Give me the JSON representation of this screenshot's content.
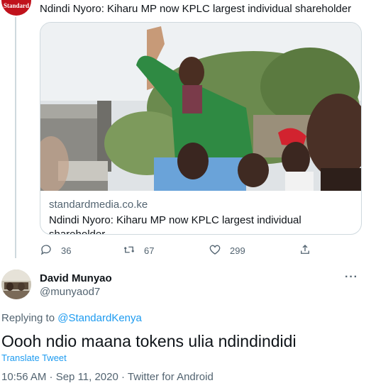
{
  "parent_tweet": {
    "avatar_text": "Standard",
    "text": "Ndindi Nyoro: Kiharu MP now KPLC largest individual shareholder"
  },
  "card": {
    "domain": "standardmedia.co.ke",
    "title": "Ndindi Nyoro: Kiharu MP now KPLC largest individual shareholder"
  },
  "actions": {
    "replies": "36",
    "retweets": "67",
    "likes": "299"
  },
  "reply_tweet": {
    "name": "David Munyao",
    "handle": "@munyaod7",
    "more": "···",
    "replying_prefix": "Replying to",
    "replying_to": "@StandardKenya",
    "text": "Oooh ndio maana tokens ulia ndindindidi",
    "translate": "Translate Tweet",
    "timestamp": "10:56 AM · Sep 11, 2020 · Twitter for Android"
  },
  "colors": {
    "link": "#1d9bf0",
    "muted": "#536471",
    "brand": "#c0121c"
  }
}
